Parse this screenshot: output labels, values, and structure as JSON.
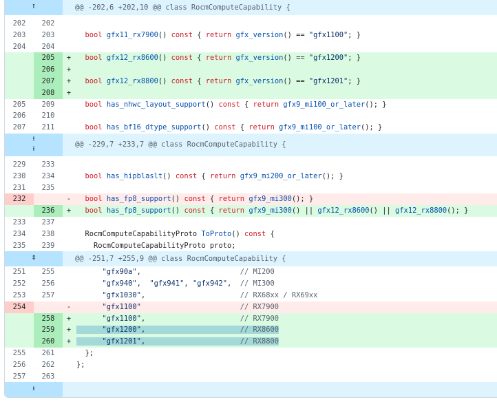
{
  "hunks": [
    {
      "header": "@@ -202,6 +202,10 @@ class RocmComputeCapability {",
      "expander": "expand-up"
    },
    {
      "header": "@@ -229,7 +233,7 @@ class RocmComputeCapability {",
      "expander": "expand-both"
    },
    {
      "header": "@@ -251,7 +255,9 @@ class RocmComputeCapability {",
      "expander": "expand-both"
    },
    {
      "header": "",
      "expander": "expand-down"
    }
  ],
  "lines": [
    {
      "old": "202",
      "new": "202",
      "type": "ctx",
      "sign": "",
      "text": ""
    },
    {
      "old": "203",
      "new": "203",
      "type": "ctx",
      "sign": "",
      "text": "  bool gfx11_rx7900() const { return gfx_version() == \"gfx1100\"; }"
    },
    {
      "old": "204",
      "new": "204",
      "type": "ctx",
      "sign": "",
      "text": ""
    },
    {
      "old": "",
      "new": "205",
      "type": "add",
      "sign": "+",
      "text": "  bool gfx12_rx8600() const { return gfx_version() == \"gfx1200\"; }"
    },
    {
      "old": "",
      "new": "206",
      "type": "add",
      "sign": "+",
      "text": ""
    },
    {
      "old": "",
      "new": "207",
      "type": "add",
      "sign": "+",
      "text": "  bool gfx12_rx8800() const { return gfx_version() == \"gfx1201\"; }"
    },
    {
      "old": "",
      "new": "208",
      "type": "add",
      "sign": "+",
      "text": ""
    },
    {
      "old": "205",
      "new": "209",
      "type": "ctx",
      "sign": "",
      "text": "  bool has_nhwc_layout_support() const { return gfx9_mi100_or_later(); }"
    },
    {
      "old": "206",
      "new": "210",
      "type": "ctx",
      "sign": "",
      "text": ""
    },
    {
      "old": "207",
      "new": "211",
      "type": "ctx",
      "sign": "",
      "text": "  bool has_bf16_dtype_support() const { return gfx9_mi100_or_later(); }"
    },
    {
      "old": "229",
      "new": "233",
      "type": "ctx",
      "sign": "",
      "text": ""
    },
    {
      "old": "230",
      "new": "234",
      "type": "ctx",
      "sign": "",
      "text": "  bool has_hipblaslt() const { return gfx9_mi200_or_later(); }"
    },
    {
      "old": "231",
      "new": "235",
      "type": "ctx",
      "sign": "",
      "text": ""
    },
    {
      "old": "232",
      "new": "",
      "type": "del",
      "sign": "-",
      "text": "  bool has_fp8_support() const { return gfx9_mi300(); }"
    },
    {
      "old": "",
      "new": "236",
      "type": "add",
      "sign": "+",
      "text": "  bool has_fp8_support() const { return gfx9_mi300() || gfx12_rx8600() || gfx12_rx8800(); }"
    },
    {
      "old": "233",
      "new": "237",
      "type": "ctx",
      "sign": "",
      "text": ""
    },
    {
      "old": "234",
      "new": "238",
      "type": "ctx",
      "sign": "",
      "text": "  RocmComputeCapabilityProto ToProto() const {"
    },
    {
      "old": "235",
      "new": "239",
      "type": "ctx",
      "sign": "",
      "text": "    RocmComputeCapabilityProto proto;"
    },
    {
      "old": "251",
      "new": "255",
      "type": "ctx",
      "sign": "",
      "text": "      \"gfx90a\",                       // MI200"
    },
    {
      "old": "252",
      "new": "256",
      "type": "ctx",
      "sign": "",
      "text": "      \"gfx940\",  \"gfx941\", \"gfx942\",  // MI300"
    },
    {
      "old": "253",
      "new": "257",
      "type": "ctx",
      "sign": "",
      "text": "      \"gfx1030\",                      // RX68xx / RX69xx"
    },
    {
      "old": "254",
      "new": "",
      "type": "del",
      "sign": "-",
      "text": "      \"gfx1100\"                       // RX7900"
    },
    {
      "old": "",
      "new": "258",
      "type": "add",
      "sign": "+",
      "text": "      \"gfx1100\",                      // RX7900"
    },
    {
      "old": "",
      "new": "259",
      "type": "add",
      "sign": "+",
      "text": "      \"gfx1200\",                      // RX8600"
    },
    {
      "old": "",
      "new": "260",
      "type": "add",
      "sign": "+",
      "text": "      \"gfx1201\",                      // RX8800"
    },
    {
      "old": "255",
      "new": "261",
      "type": "ctx",
      "sign": "",
      "text": "  };"
    },
    {
      "old": "256",
      "new": "262",
      "type": "ctx",
      "sign": "",
      "text": "};"
    },
    {
      "old": "257",
      "new": "263",
      "type": "ctx",
      "sign": "",
      "text": ""
    }
  ],
  "colors": {
    "hunk_bg": "#ddf4ff",
    "expander_bg": "#b6e3ff",
    "add_bg": "#dafbe1",
    "add_num_bg": "#aceebb",
    "del_bg": "#ffebe9",
    "del_num_bg": "#ffcecb",
    "word_add_bg": "#abf2bc"
  }
}
